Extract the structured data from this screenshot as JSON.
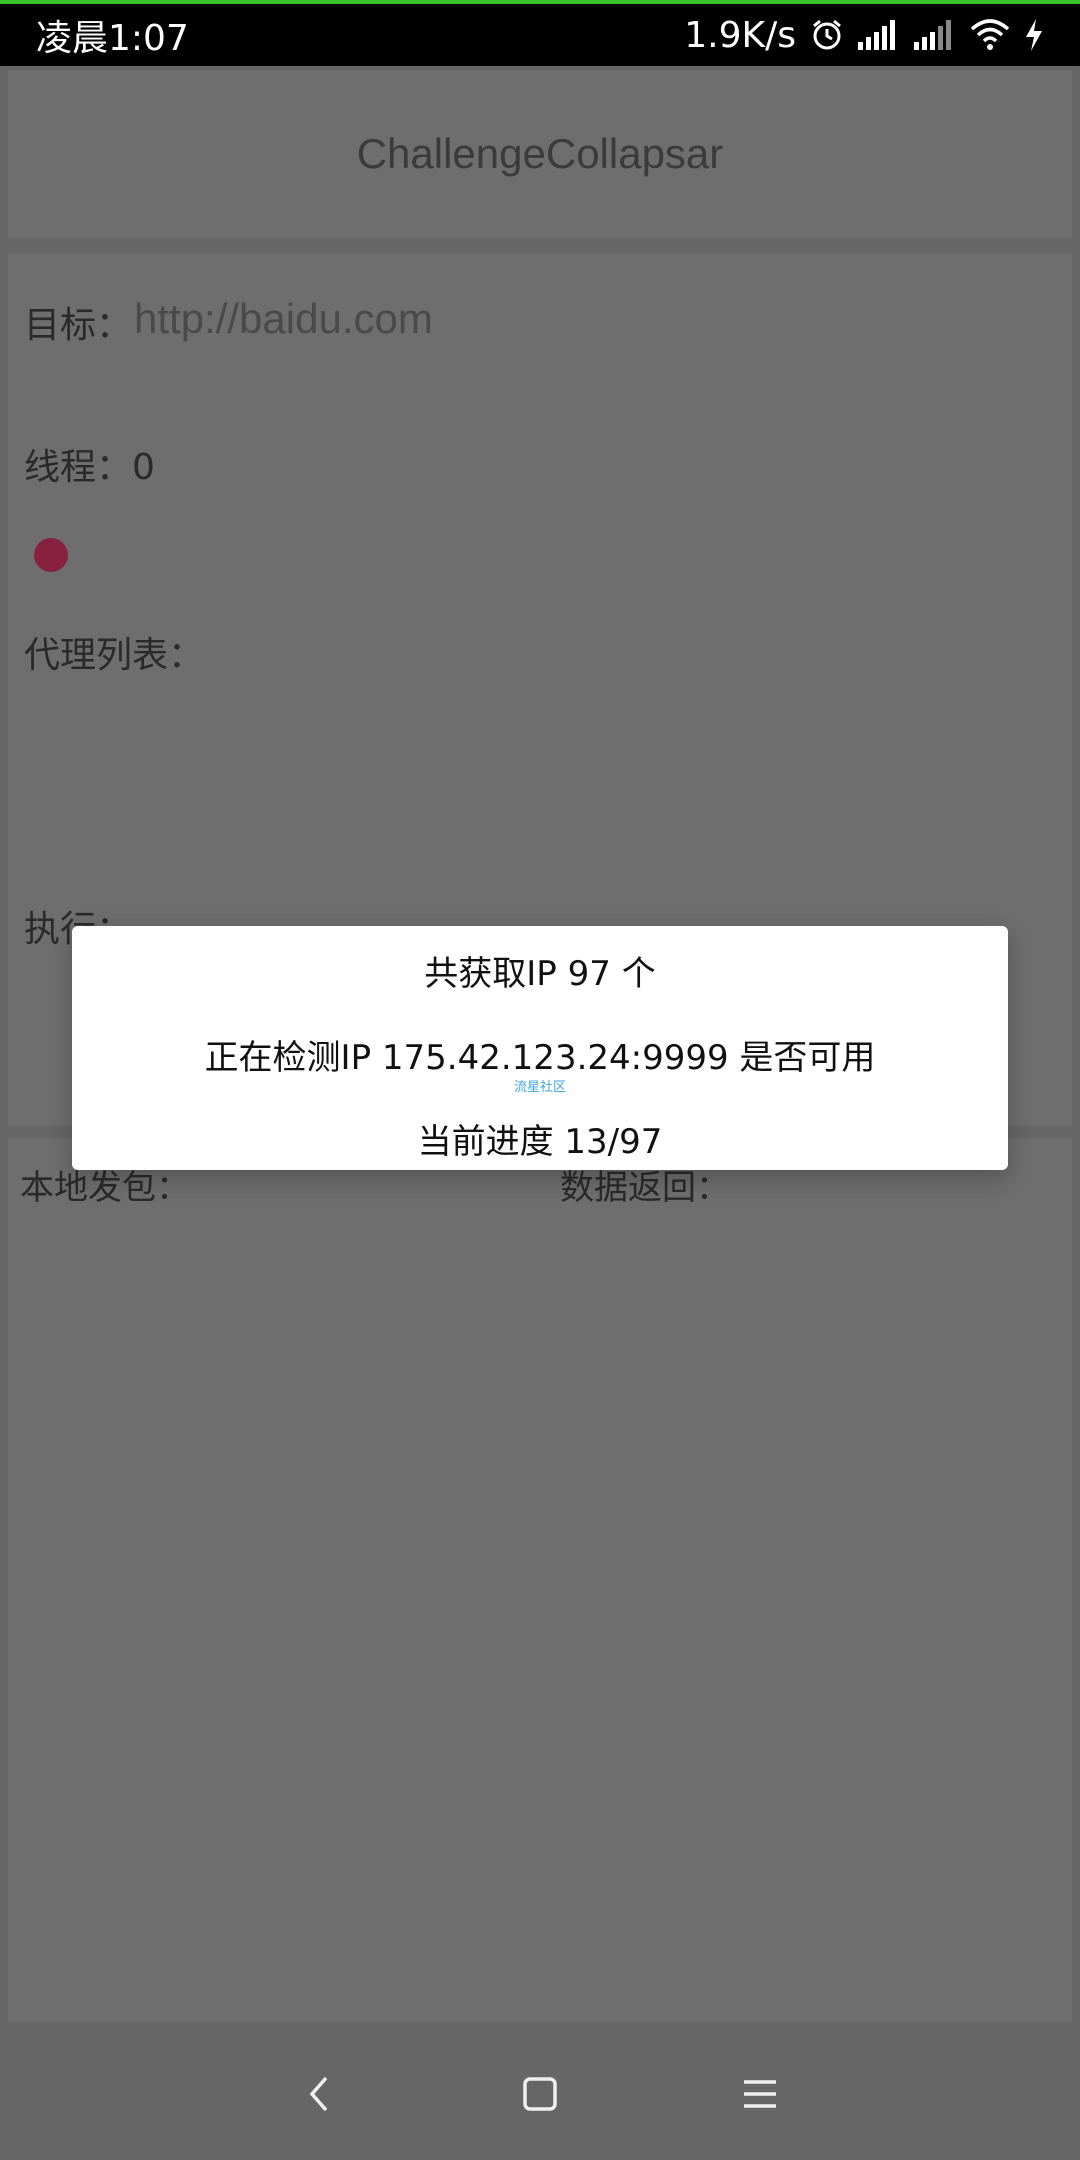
{
  "status_bar": {
    "time": "凌晨1:07",
    "net_speed": "1.9K/s",
    "icons": [
      "alarm-icon",
      "signal-icon",
      "signal-icon",
      "wifi-icon",
      "charging-icon"
    ]
  },
  "app": {
    "title": "ChallengeCollapsar"
  },
  "form": {
    "target_label": "目标：",
    "target_value": "http://baidu.com",
    "threads_text": "线程：0",
    "proxy_list_label": "代理列表：",
    "execute_label": "执行："
  },
  "output": {
    "local_send_label": "本地发包：",
    "data_return_label": "数据返回："
  },
  "dialog": {
    "line1": "共获取IP 97 个",
    "line2": "正在检测IP 175.42.123.24:9999 是否可用",
    "watermark": "流星社区",
    "line3": "当前进度 13/97"
  },
  "colors": {
    "status_bar": "#000000",
    "progress_line": "#3ac22c",
    "indicator_dot": "#88213f",
    "overlay": "#666666",
    "dialog": "#ffffff"
  },
  "nav": {
    "icons": [
      "back-icon",
      "home-icon",
      "menu-icon"
    ]
  }
}
